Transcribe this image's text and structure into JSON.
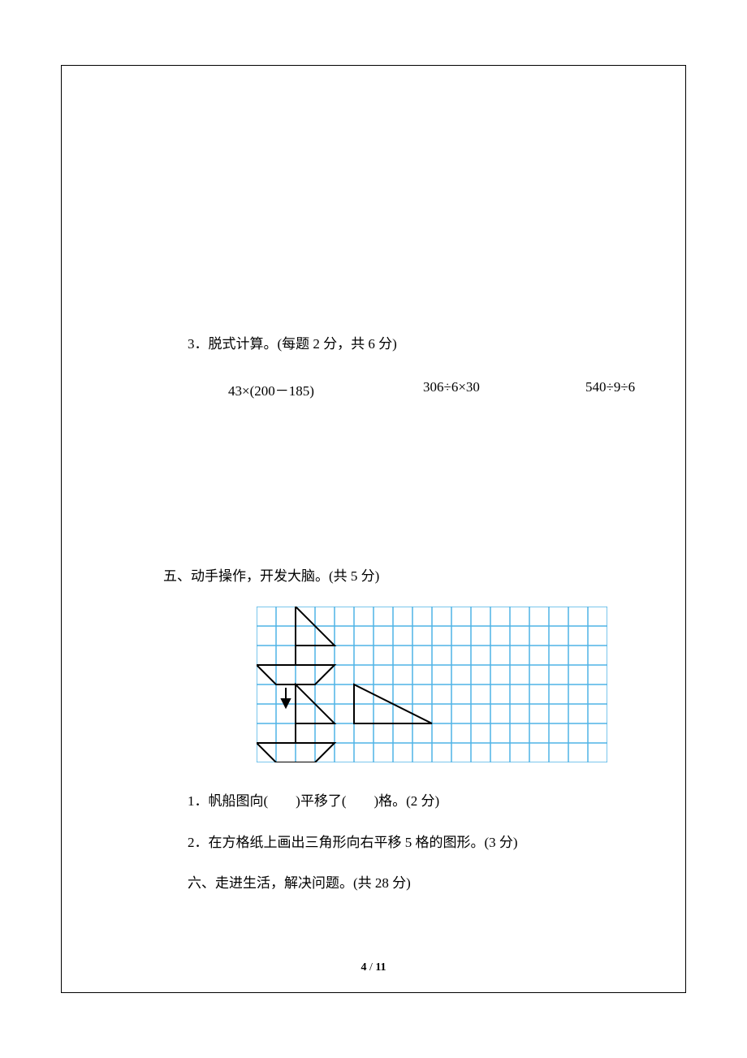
{
  "q3": {
    "title": "3．脱式计算。(每题 2 分，共 6 分)",
    "exp1": "43×(200－185)",
    "exp2": "306÷6×30",
    "exp3": "540÷9÷6"
  },
  "section5": {
    "title": "五、动手操作，开发大脑。(共 5 分)",
    "q1": "1．帆船图向(　　)平移了(　　)格。(2 分)",
    "q2": "2．在方格纸上画出三角形向右平移 5 格的图形。(3 分)"
  },
  "section6": {
    "title": "六、走进生活，解决问题。(共 28 分)"
  },
  "page": {
    "current": "4",
    "total": "11"
  },
  "grid": {
    "cols": 18,
    "rows": 8,
    "cell_size": 24
  }
}
